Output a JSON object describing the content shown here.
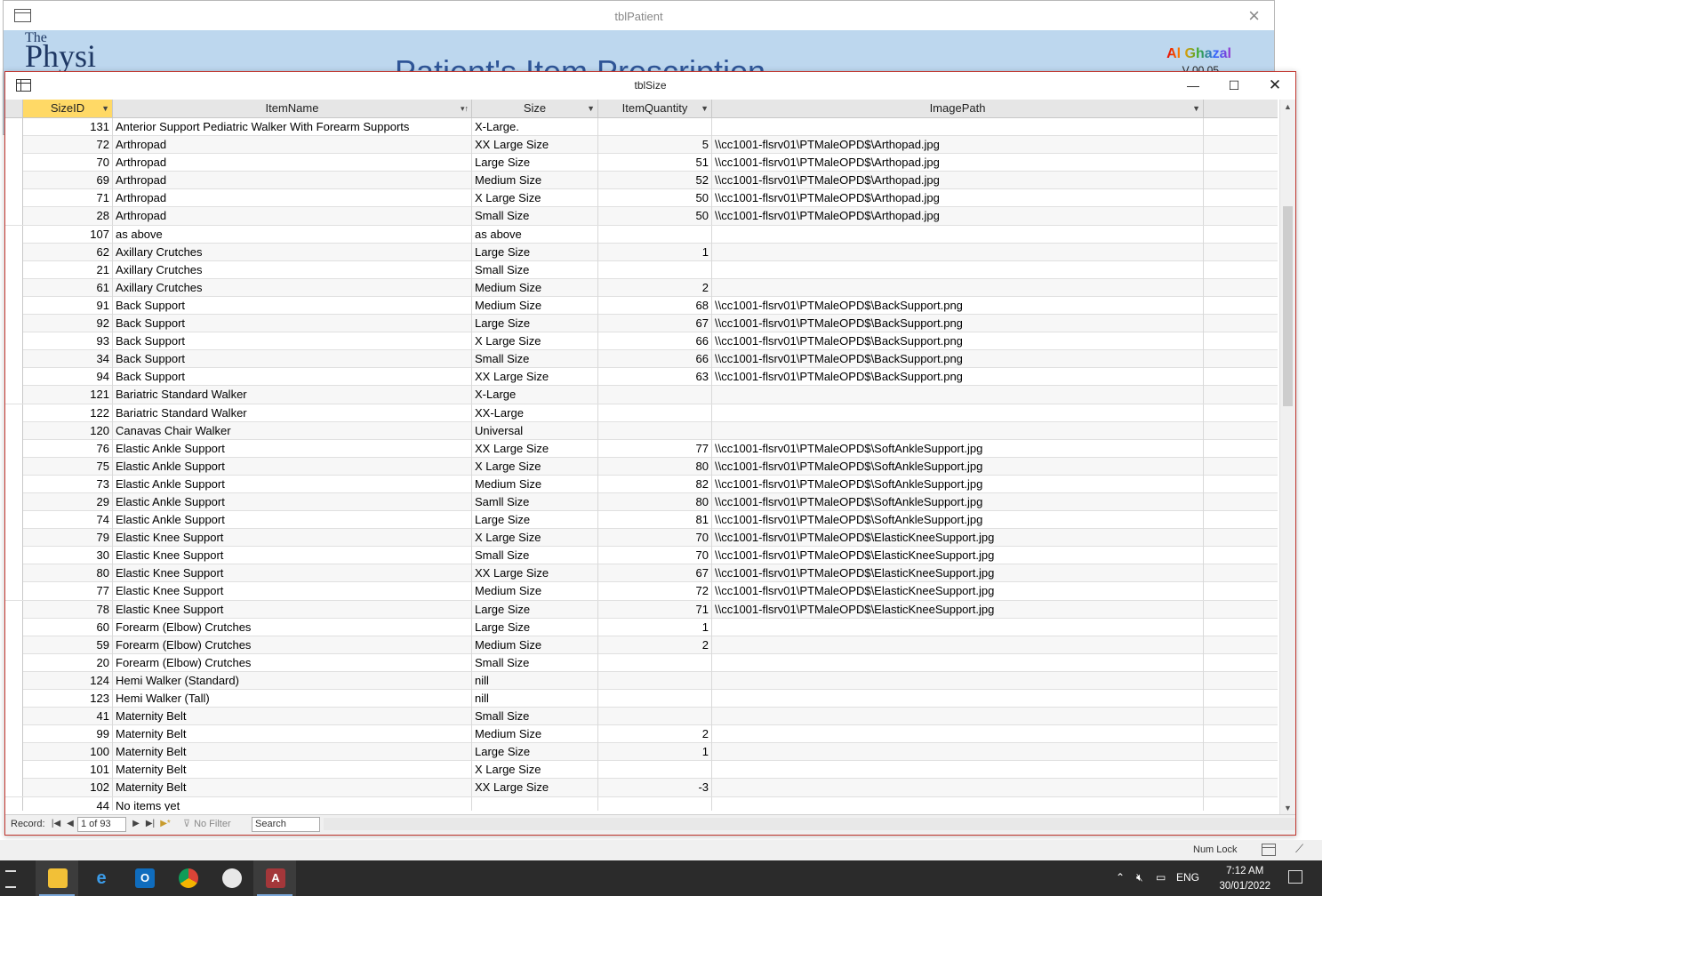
{
  "background_window": {
    "title": "tblPatient",
    "logo_small": "The",
    "logo_big": "Physi",
    "heading": "Patient's Item Prescription",
    "brand": "Al Ghazal",
    "version": "V 00.05"
  },
  "window": {
    "title": "tblSize",
    "min": "—",
    "max": "☐",
    "close": "✕"
  },
  "columns": {
    "size_id": "SizeID",
    "item_name": "ItemName",
    "size": "Size",
    "item_quantity": "ItemQuantity",
    "image_path": "ImagePath"
  },
  "rows": [
    {
      "id": "131",
      "name": "Anterior Support Pediatric Walker With Forearm Supports",
      "size": "X-Large.",
      "qty": "",
      "path": ""
    },
    {
      "id": "72",
      "name": "Arthropad",
      "size": "XX Large Size",
      "qty": "5",
      "path": "\\\\cc1001-flsrv01\\PTMaleOPD$\\Arthopad.jpg"
    },
    {
      "id": "70",
      "name": "Arthropad",
      "size": "Large Size",
      "qty": "51",
      "path": "\\\\cc1001-flsrv01\\PTMaleOPD$\\Arthopad.jpg"
    },
    {
      "id": "69",
      "name": "Arthropad",
      "size": "Medium Size",
      "qty": "52",
      "path": "\\\\cc1001-flsrv01\\PTMaleOPD$\\Arthopad.jpg"
    },
    {
      "id": "71",
      "name": "Arthropad",
      "size": "X Large Size",
      "qty": "50",
      "path": "\\\\cc1001-flsrv01\\PTMaleOPD$\\Arthopad.jpg"
    },
    {
      "id": "28",
      "name": "Arthropad",
      "size": "Small Size",
      "qty": "50",
      "path": "\\\\cc1001-flsrv01\\PTMaleOPD$\\Arthopad.jpg"
    },
    {
      "id": "107",
      "name": "as above",
      "size": "as above",
      "qty": "",
      "path": ""
    },
    {
      "id": "62",
      "name": "Axillary Crutches",
      "size": "Large Size",
      "qty": "1",
      "path": ""
    },
    {
      "id": "21",
      "name": "Axillary Crutches",
      "size": "Small Size",
      "qty": "",
      "path": ""
    },
    {
      "id": "61",
      "name": "Axillary Crutches",
      "size": "Medium Size",
      "qty": "2",
      "path": ""
    },
    {
      "id": "91",
      "name": "Back Support",
      "size": "Medium Size",
      "qty": "68",
      "path": "\\\\cc1001-flsrv01\\PTMaleOPD$\\BackSupport.png"
    },
    {
      "id": "92",
      "name": "Back Support",
      "size": "Large Size",
      "qty": "67",
      "path": "\\\\cc1001-flsrv01\\PTMaleOPD$\\BackSupport.png"
    },
    {
      "id": "93",
      "name": "Back Support",
      "size": "X Large Size",
      "qty": "66",
      "path": "\\\\cc1001-flsrv01\\PTMaleOPD$\\BackSupport.png"
    },
    {
      "id": "34",
      "name": "Back Support",
      "size": "Small Size",
      "qty": "66",
      "path": "\\\\cc1001-flsrv01\\PTMaleOPD$\\BackSupport.png"
    },
    {
      "id": "94",
      "name": "Back Support",
      "size": "XX Large Size",
      "qty": "63",
      "path": "\\\\cc1001-flsrv01\\PTMaleOPD$\\BackSupport.png"
    },
    {
      "id": "121",
      "name": "Bariatric Standard Walker",
      "size": "X-Large",
      "qty": "",
      "path": ""
    },
    {
      "id": "122",
      "name": "Bariatric Standard Walker",
      "size": "XX-Large",
      "qty": "",
      "path": ""
    },
    {
      "id": "120",
      "name": "Canavas Chair Walker",
      "size": "Universal",
      "qty": "",
      "path": ""
    },
    {
      "id": "76",
      "name": "Elastic Ankle Support",
      "size": "XX Large Size",
      "qty": "77",
      "path": "\\\\cc1001-flsrv01\\PTMaleOPD$\\SoftAnkleSupport.jpg"
    },
    {
      "id": "75",
      "name": "Elastic Ankle Support",
      "size": "X Large Size",
      "qty": "80",
      "path": "\\\\cc1001-flsrv01\\PTMaleOPD$\\SoftAnkleSupport.jpg"
    },
    {
      "id": "73",
      "name": "Elastic Ankle Support",
      "size": "Medium Size",
      "qty": "82",
      "path": "\\\\cc1001-flsrv01\\PTMaleOPD$\\SoftAnkleSupport.jpg"
    },
    {
      "id": "29",
      "name": "Elastic Ankle Support",
      "size": "Samll Size",
      "qty": "80",
      "path": "\\\\cc1001-flsrv01\\PTMaleOPD$\\SoftAnkleSupport.jpg"
    },
    {
      "id": "74",
      "name": "Elastic Ankle Support",
      "size": "Large Size",
      "qty": "81",
      "path": "\\\\cc1001-flsrv01\\PTMaleOPD$\\SoftAnkleSupport.jpg"
    },
    {
      "id": "79",
      "name": "Elastic Knee Support",
      "size": "X Large Size",
      "qty": "70",
      "path": "\\\\cc1001-flsrv01\\PTMaleOPD$\\ElasticKneeSupport.jpg"
    },
    {
      "id": "30",
      "name": "Elastic Knee Support",
      "size": "Small Size",
      "qty": "70",
      "path": "\\\\cc1001-flsrv01\\PTMaleOPD$\\ElasticKneeSupport.jpg"
    },
    {
      "id": "80",
      "name": "Elastic Knee Support",
      "size": "XX Large Size",
      "qty": "67",
      "path": "\\\\cc1001-flsrv01\\PTMaleOPD$\\ElasticKneeSupport.jpg"
    },
    {
      "id": "77",
      "name": "Elastic Knee Support",
      "size": "Medium Size",
      "qty": "72",
      "path": "\\\\cc1001-flsrv01\\PTMaleOPD$\\ElasticKneeSupport.jpg"
    },
    {
      "id": "78",
      "name": "Elastic Knee Support",
      "size": "Large Size",
      "qty": "71",
      "path": "\\\\cc1001-flsrv01\\PTMaleOPD$\\ElasticKneeSupport.jpg"
    },
    {
      "id": "60",
      "name": "Forearm (Elbow) Crutches",
      "size": "Large Size",
      "qty": "1",
      "path": ""
    },
    {
      "id": "59",
      "name": "Forearm (Elbow) Crutches",
      "size": "Medium Size",
      "qty": "2",
      "path": ""
    },
    {
      "id": "20",
      "name": "Forearm (Elbow) Crutches",
      "size": "Small Size",
      "qty": "",
      "path": ""
    },
    {
      "id": "124",
      "name": "Hemi Walker (Standard)",
      "size": "nill",
      "qty": "",
      "path": ""
    },
    {
      "id": "123",
      "name": "Hemi Walker (Tall)",
      "size": "nill",
      "qty": "",
      "path": ""
    },
    {
      "id": "41",
      "name": "Maternity Belt",
      "size": "Small Size",
      "qty": "",
      "path": ""
    },
    {
      "id": "99",
      "name": "Maternity Belt",
      "size": "Medium Size",
      "qty": "2",
      "path": ""
    },
    {
      "id": "100",
      "name": "Maternity Belt",
      "size": "Large Size",
      "qty": "1",
      "path": ""
    },
    {
      "id": "101",
      "name": "Maternity Belt",
      "size": "X Large Size",
      "qty": "",
      "path": ""
    },
    {
      "id": "102",
      "name": "Maternity Belt",
      "size": "XX Large Size",
      "qty": "-3",
      "path": ""
    },
    {
      "id": "44",
      "name": "No items yet",
      "size": "",
      "qty": "",
      "path": ""
    }
  ],
  "navigation": {
    "label": "Record:",
    "record": "1 of 93",
    "filter": "No Filter",
    "search": "Search"
  },
  "status_bar": {
    "num_lock": "Num Lock"
  },
  "taskbar": {
    "language": "ENG",
    "time": "7:12 AM",
    "date": "30/01/2022"
  },
  "colors": {
    "window_border": "#c1352d",
    "selected_header": "#ffd966",
    "form_background": "#bdd7ee",
    "taskbar": "#2b2b2b"
  }
}
